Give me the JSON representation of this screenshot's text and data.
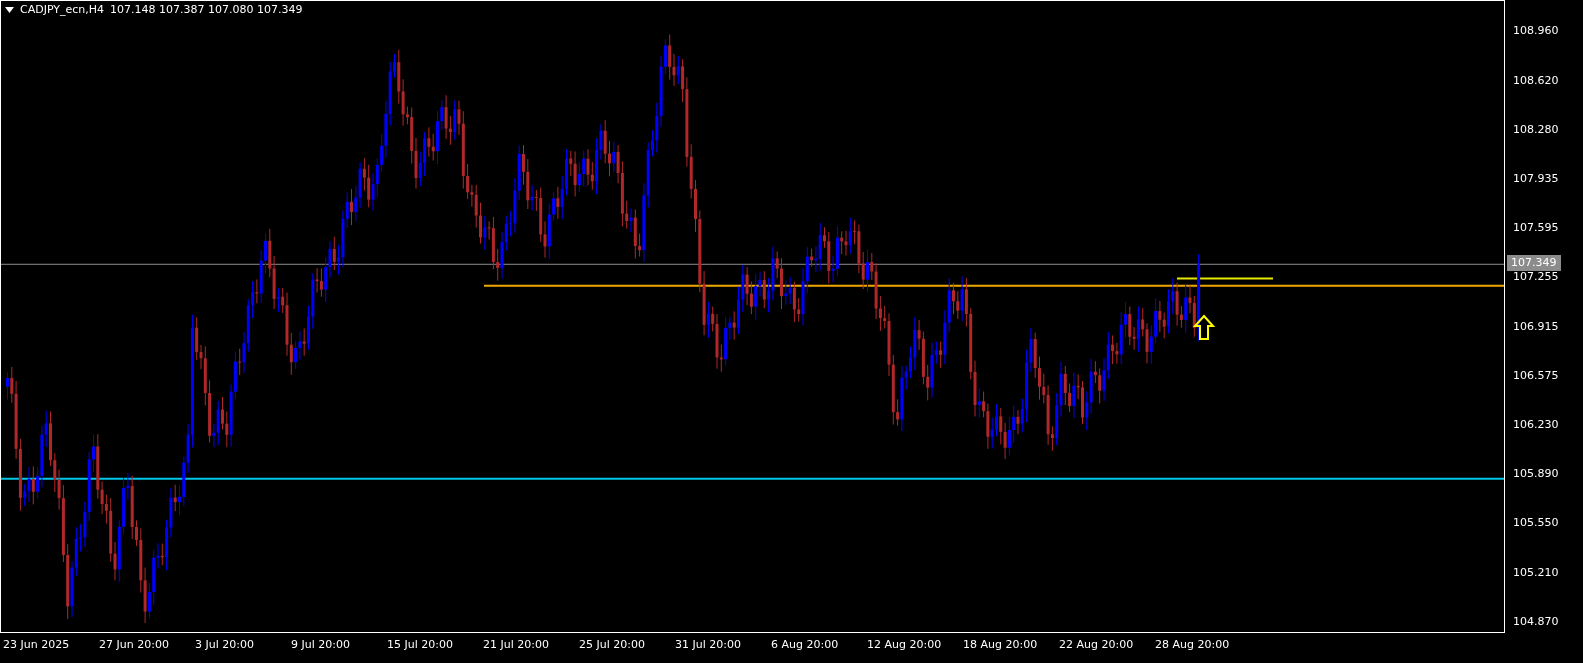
{
  "chart": {
    "symbol": "CADJPY_ecn,H4",
    "ohlc": "107.148 107.387 107.080 107.349"
  },
  "price_axis": {
    "labels": [
      "108.960",
      "108.620",
      "108.280",
      "107.935",
      "107.595",
      "107.255",
      "106.915",
      "106.575",
      "106.230",
      "105.890",
      "105.550",
      "105.210",
      "104.870"
    ],
    "current_price": "107.349"
  },
  "time_axis": {
    "labels": [
      "23 Jun 2025",
      "27 Jun 20:00",
      "3 Jul 20:00",
      "9 Jul 20:00",
      "15 Jul 20:00",
      "21 Jul 20:00",
      "25 Jul 20:00",
      "31 Jul 20:00",
      "6 Aug 20:00",
      "12 Aug 20:00",
      "18 Aug 20:00",
      "22 Aug 20:00",
      "28 Aug 20:00"
    ]
  }
}
